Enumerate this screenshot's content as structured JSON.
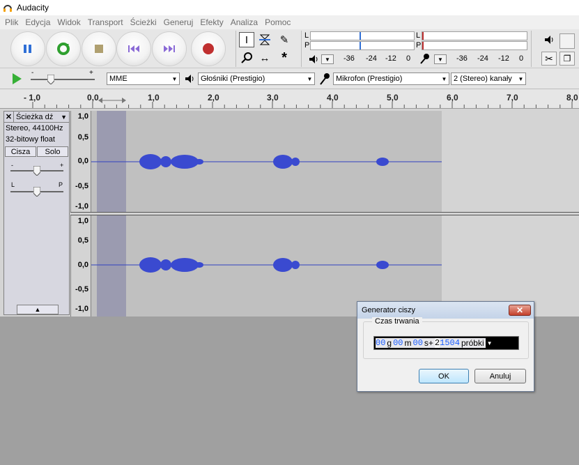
{
  "window": {
    "title": "Audacity"
  },
  "menu": [
    "Plik",
    "Edycja",
    "Widok",
    "Transport",
    "Ścieżki",
    "Generuj",
    "Efekty",
    "Analiza",
    "Pomoc"
  ],
  "meters": {
    "play_l": "L",
    "play_r": "P",
    "rec_l": "L",
    "rec_r": "P",
    "play_scale": [
      "-36",
      "-24",
      "-12",
      "0"
    ],
    "rec_scale": [
      "-36",
      "-24",
      "-12",
      "0"
    ]
  },
  "devices": {
    "slider_minus": "-",
    "slider_plus": "+",
    "host": "MME",
    "output": "Głośniki (Prestigio)",
    "input": "Mikrofon (Prestigio)",
    "channels": "2 (Stereo) kanały"
  },
  "ruler": [
    "- 1,0",
    "0,0",
    "1,0",
    "2,0",
    "3,0",
    "4,0",
    "5,0",
    "6,0",
    "7,0",
    "8,0"
  ],
  "track": {
    "name": "Ścieżka dź",
    "info1": "Stereo, 44100Hz",
    "info2": "32-bitowy float",
    "mute": "Cisza",
    "solo": "Solo",
    "gain_minus": "-",
    "gain_plus": "+",
    "pan_l": "L",
    "pan_r": "P",
    "y_labels": [
      "1,0",
      "0,5",
      "0,0",
      "-0,5",
      "-1,0"
    ]
  },
  "dialog": {
    "title": "Generator ciszy",
    "group": "Czas trwania",
    "duration": {
      "h": "00",
      "h_lbl": "g",
      "m": "00",
      "m_lbl": "m",
      "s": "00",
      "s_lbl": "s+",
      "samples_first": "2",
      "samples_rest": "1504",
      "samples_lbl": "próbki"
    },
    "ok": "OK",
    "cancel": "Anuluj"
  }
}
